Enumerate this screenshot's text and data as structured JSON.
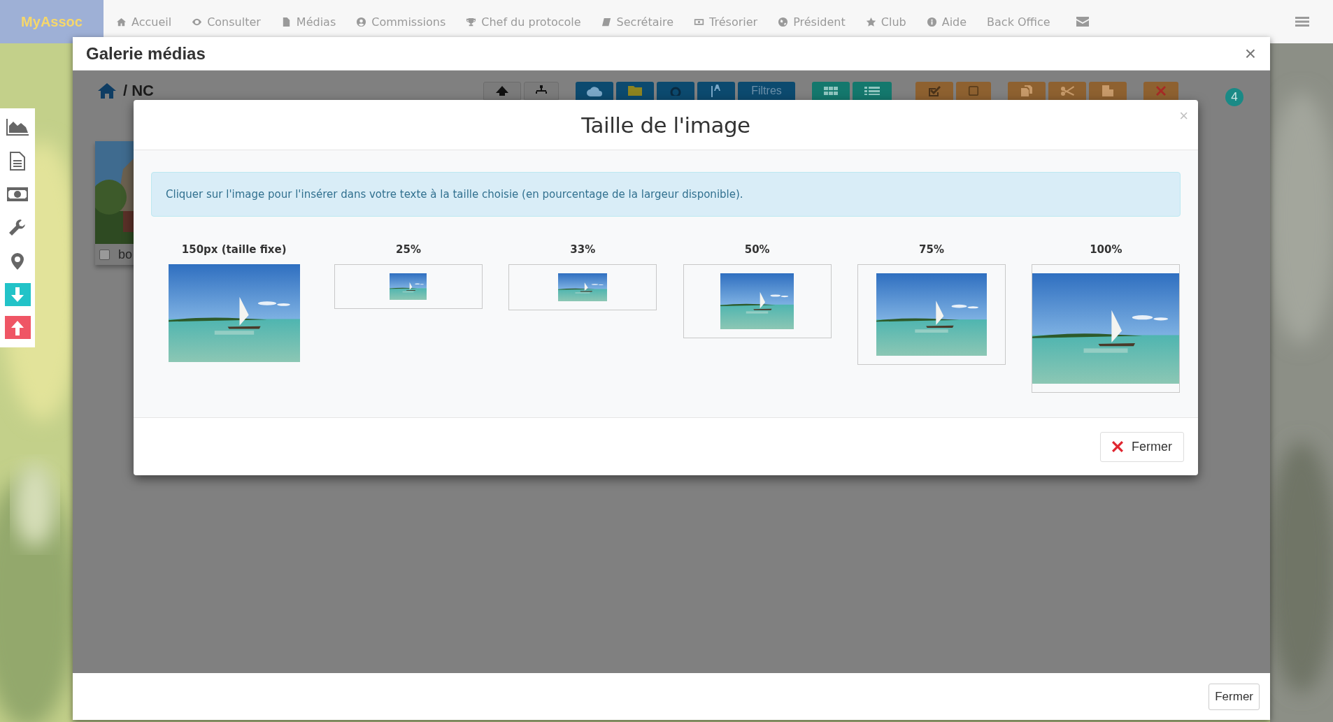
{
  "navbar": {
    "brand": "MyAssoc",
    "items": [
      {
        "label": "Accueil"
      },
      {
        "label": "Consulter"
      },
      {
        "label": "Médias"
      },
      {
        "label": "Commissions"
      },
      {
        "label": "Chef du protocole"
      },
      {
        "label": "Secrétaire"
      },
      {
        "label": "Trésorier"
      },
      {
        "label": "Président"
      },
      {
        "label": "Club"
      },
      {
        "label": "Aide"
      },
      {
        "label": "Back Office"
      }
    ]
  },
  "gallery": {
    "title": "Galerie médias",
    "close_icon": "×",
    "breadcrumb": "/ NC",
    "filter_button": "Filtres",
    "badge": "4",
    "media": [
      {
        "name": "bo",
        "checked": false
      }
    ],
    "close_button": "Fermer"
  },
  "size_modal": {
    "title": "Taille de l'image",
    "close_icon": "×",
    "info": "Cliquer sur l'image pour l'insérer dans votre texte à la taille choisie (en pourcentage de la largeur disponible).",
    "sizes": [
      {
        "label": "150px (taille fixe)",
        "kind": "fixed"
      },
      {
        "label": "25%",
        "kind": "percent"
      },
      {
        "label": "33%",
        "kind": "percent"
      },
      {
        "label": "50%",
        "kind": "percent"
      },
      {
        "label": "75%",
        "kind": "percent"
      },
      {
        "label": "100%",
        "kind": "percent"
      }
    ],
    "close_button": "Fermer"
  }
}
